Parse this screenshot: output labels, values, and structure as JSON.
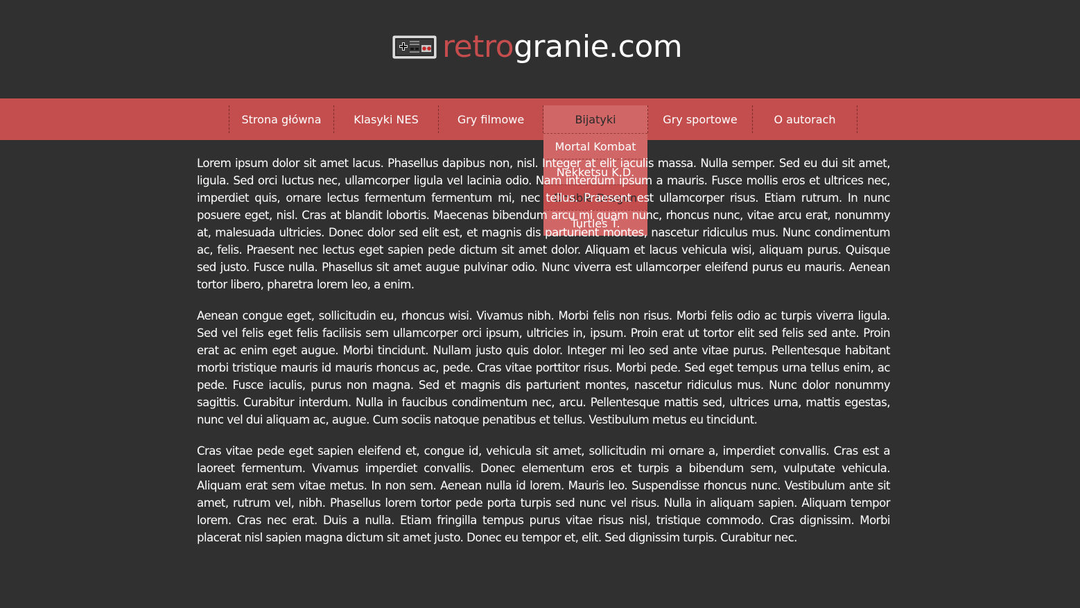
{
  "header": {
    "logo_accent": "retro",
    "logo_rest": "granie.com",
    "logo_icon": "nes-controller-icon"
  },
  "colors": {
    "background": "#303030",
    "accent": "#c44e4e",
    "dropdown": "#d06666",
    "text": "#ffffff"
  },
  "nav": {
    "items": [
      {
        "label": "Strona główna"
      },
      {
        "label": "Klasyki NES"
      },
      {
        "label": "Gry filmowe"
      },
      {
        "label": "Bijatyki"
      },
      {
        "label": "Gry sportowe"
      },
      {
        "label": "O autorach"
      }
    ],
    "dropdown": [
      {
        "label": "Mortal Kombat"
      },
      {
        "label": "Nekketsu K.D."
      },
      {
        "label": "Double Dragon"
      },
      {
        "label": "Turtles T."
      }
    ]
  },
  "content": {
    "paragraphs": [
      "Lorem ipsum dolor sit amet lacus. Phasellus dapibus non, nisl. Integer at elit iaculis massa. Nulla semper. Sed eu dui sit amet, ligula. Sed orci luctus nec, ullamcorper ligula vel lacinia odio. Nam interdum ipsum a mauris. Fusce mollis eros et ultrices nec, imperdiet quis, ornare lectus fermentum fermentum mi, nec tellus. Praesent est ullamcorper risus. Etiam rutrum. In nunc posuere eget, nisl. Cras at blandit lobortis. Maecenas bibendum arcu mi quam nunc, rhoncus nunc, vitae arcu erat, nonummy at, malesuada ultricies. Donec dolor sed elit est, et magnis dis parturient montes, nascetur ridiculus mus. Nunc condimentum ac, felis. Praesent nec lectus eget sapien pede dictum sit amet dolor. Aliquam et lacus vehicula wisi, aliquam purus. Quisque sed justo. Fusce nulla. Phasellus sit amet augue pulvinar odio. Nunc viverra est ullamcorper eleifend purus eu mauris. Aenean tortor libero, pharetra lorem leo, a enim.",
      "Aenean congue eget, sollicitudin eu, rhoncus wisi. Vivamus nibh. Morbi felis non risus. Morbi felis odio ac turpis viverra ligula. Sed vel felis eget felis facilisis sem ullamcorper orci ipsum, ultricies in, ipsum. Proin erat ut tortor elit sed felis sed ante. Proin erat ac enim eget augue. Morbi tincidunt. Nullam justo quis dolor. Integer mi leo sed ante vitae purus. Pellentesque habitant morbi tristique mauris id mauris rhoncus ac, pede. Cras vitae porttitor risus. Morbi pede. Sed eget tempus urna tellus enim, ac pede. Fusce iaculis, purus non magna. Sed et magnis dis parturient montes, nascetur ridiculus mus. Nunc dolor nonummy sagittis. Curabitur interdum. Nulla in faucibus condimentum nec, arcu. Pellentesque mattis sed, ultrices urna, mattis egestas, nunc vel dui aliquam ac, augue. Cum sociis natoque penatibus et tellus. Vestibulum metus eu tincidunt.",
      "Cras vitae pede eget sapien eleifend et, congue id, vehicula sit amet, sollicitudin mi ornare a, imperdiet convallis. Cras est a laoreet fermentum. Vivamus imperdiet convallis. Donec elementum eros et turpis a bibendum sem, vulputate vehicula. Aliquam erat sem vitae metus. In non sem. Aenean nulla id lorem. Mauris leo. Suspendisse rhoncus nunc. Vestibulum ante sit amet, rutrum vel, nibh. Phasellus lorem tortor pede porta turpis sed nunc vel risus. Nulla in aliquam sapien. Aliquam tempor lorem. Cras nec erat. Duis a nulla. Etiam fringilla tempus purus vitae risus nisl, tristique commodo. Cras dignissim. Morbi placerat nisl sapien magna dictum sit amet justo. Donec eu tempor et, elit. Sed dignissim turpis. Curabitur nec."
    ]
  }
}
